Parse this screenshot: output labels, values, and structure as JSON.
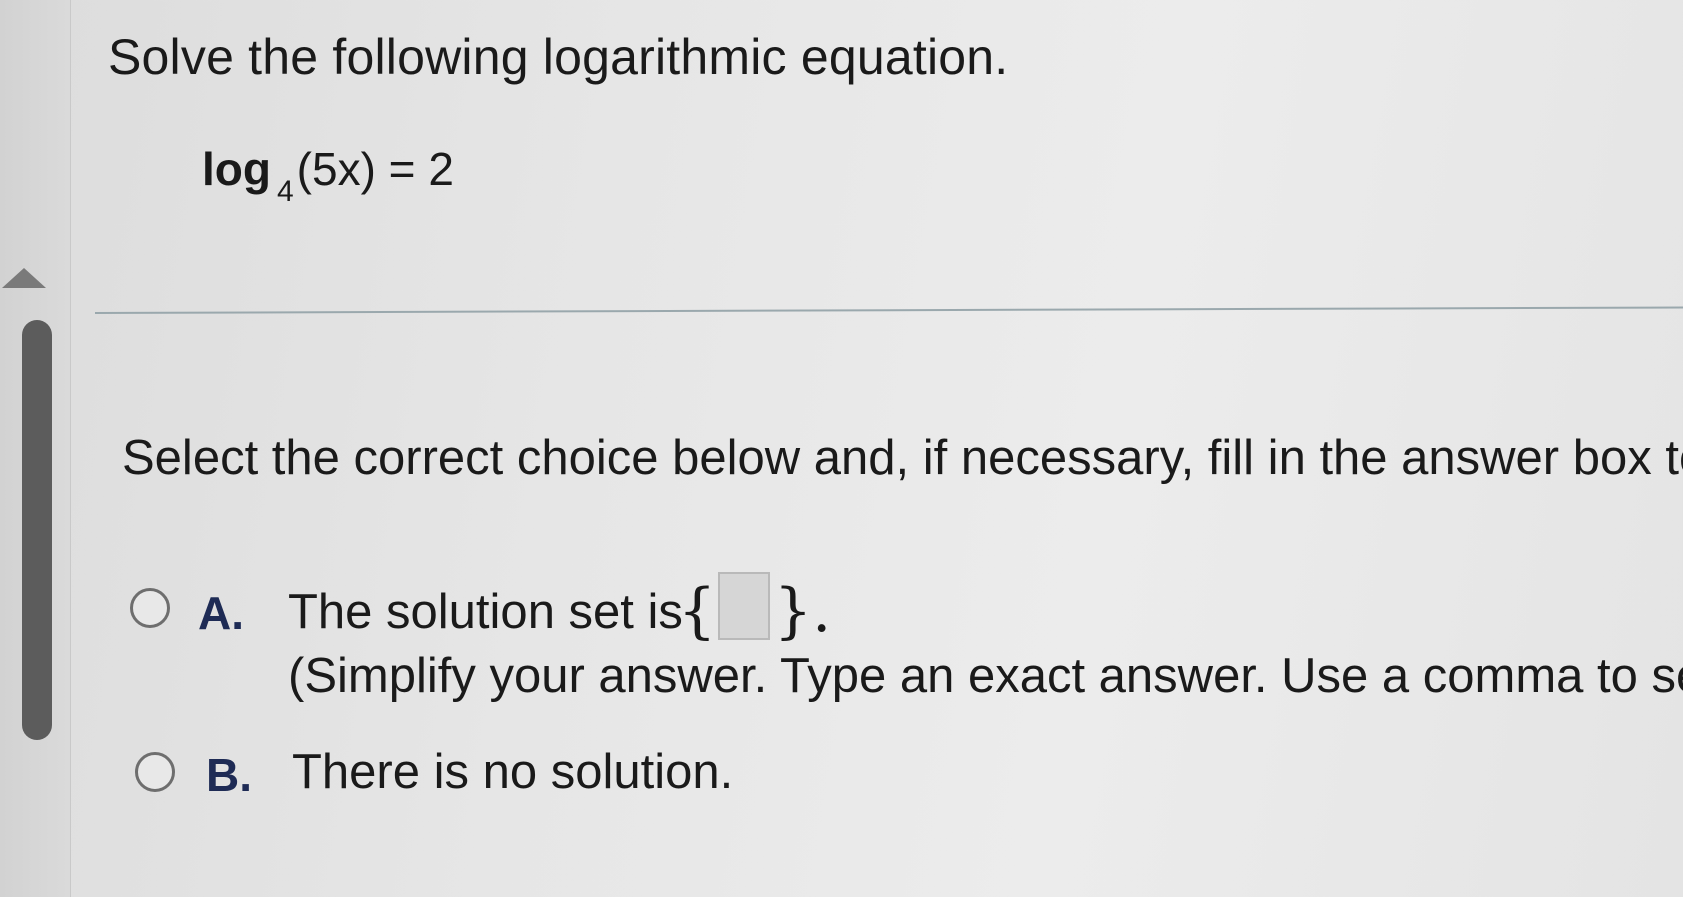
{
  "question": {
    "heading": "Solve the following logarithmic equation.",
    "equation": {
      "log_word": "log",
      "base": "4",
      "expression": "(5x) = 2"
    }
  },
  "instruction": "Select the correct choice below and, if necessary, fill in the answer box to",
  "choices": [
    {
      "letter": "A.",
      "text": "The solution set is",
      "open_brace": "{",
      "close_brace": "}.",
      "answer_value": "",
      "hint": "(Simplify your answer. Type an exact answer. Use a comma to sep"
    },
    {
      "letter": "B.",
      "text": "There is no solution."
    }
  ],
  "colors": {
    "choice_letter": "#1e2b55",
    "radio_border": "#6e6e6e",
    "divider": "#9aa8ad",
    "scroll_thumb": "#5c5c5c"
  },
  "icons": {
    "collapse": "triangle-up-icon"
  }
}
